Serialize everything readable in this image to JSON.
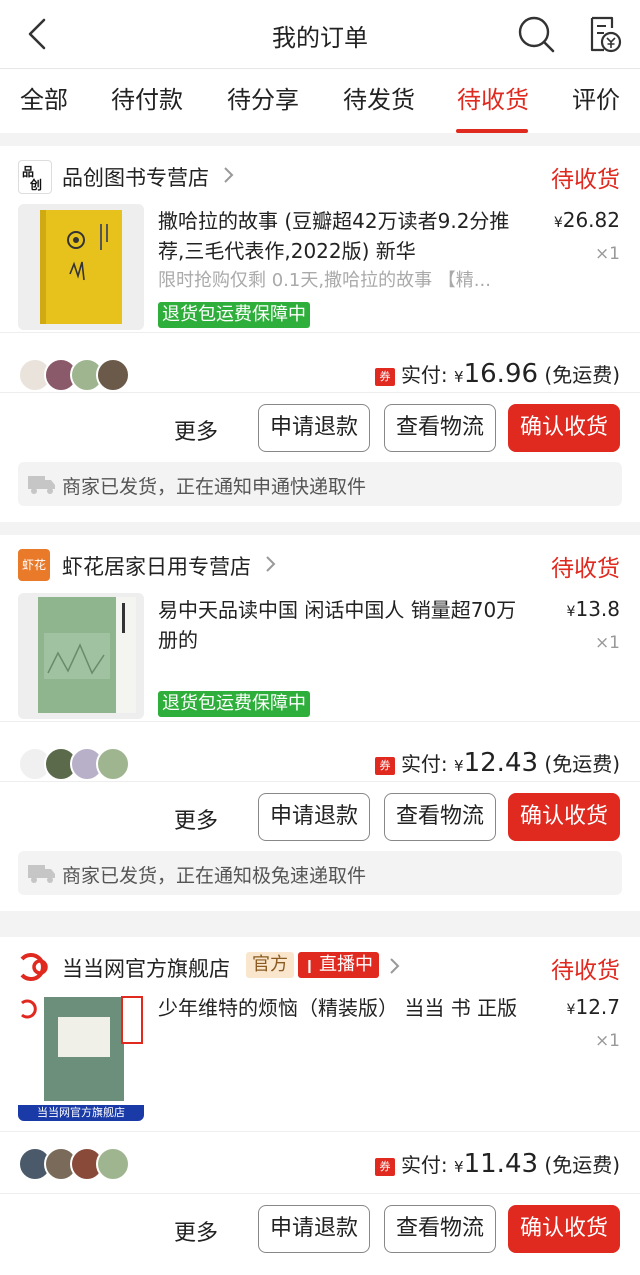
{
  "header": {
    "title": "我的订单"
  },
  "tabs": [
    {
      "label": "全部"
    },
    {
      "label": "待付款"
    },
    {
      "label": "待分享"
    },
    {
      "label": "待发货"
    },
    {
      "label": "待收货"
    },
    {
      "label": "评价"
    }
  ],
  "colors": {
    "accent": "#e0291f",
    "guarantee": "#2eae3a"
  },
  "orders": [
    {
      "store": "品创图书专营店",
      "status": "待收货",
      "title": "撒哈拉的故事 (豆瓣超42万读者9.2分推荐,三毛代表作,2022版) 新华",
      "subtitle": "限时抢购仅剩 0.1天,撒哈拉的故事 【精...",
      "price_symbol": "¥",
      "price": "26.82",
      "qty": "×1",
      "guarantee": "退货包运费保障中",
      "coupon": "券",
      "paid_label": "实付:",
      "paid_symbol": "¥",
      "paid": "16.96",
      "shipping": "(免运费)",
      "more": "更多",
      "refund": "申请退款",
      "logistics": "查看物流",
      "confirm": "确认收货",
      "notice": "商家已发货，正在通知申通快递取件"
    },
    {
      "store": "虾花居家日用专营店",
      "store_logo_text": "虾花",
      "status": "待收货",
      "title": "易中天品读中国 闲话中国人 销量超70万册的",
      "price_symbol": "¥",
      "price": "13.8",
      "qty": "×1",
      "guarantee": "退货包运费保障中",
      "coupon": "券",
      "paid_label": "实付:",
      "paid_symbol": "¥",
      "paid": "12.43",
      "shipping": "(免运费)",
      "more": "更多",
      "refund": "申请退款",
      "logistics": "查看物流",
      "confirm": "确认收货",
      "notice": "商家已发货，正在通知极兔速递取件"
    },
    {
      "store": "当当网官方旗舰店",
      "official_tag": "官方",
      "live_tag": "直播中",
      "status": "待收货",
      "title": "少年维特的烦恼（精装版） 当当 书 正版",
      "price_symbol": "¥",
      "price": "12.7",
      "qty": "×1",
      "img_caption": "当当网官方旗舰店",
      "coupon": "券",
      "paid_label": "实付:",
      "paid_symbol": "¥",
      "paid": "11.43",
      "shipping": "(免运费)",
      "more": "更多",
      "refund": "申请退款",
      "logistics": "查看物流",
      "confirm": "确认收货"
    }
  ]
}
